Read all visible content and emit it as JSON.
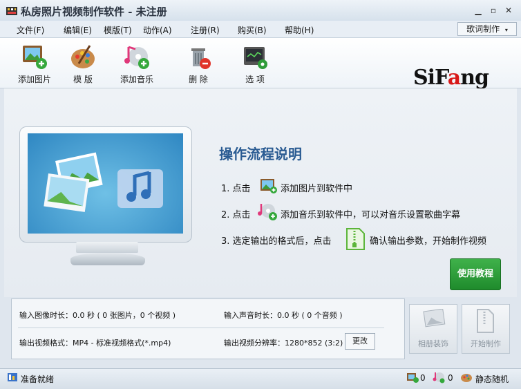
{
  "window": {
    "title": "私房照片视频制作软件 - 未注册"
  },
  "menu": [
    "文件(F)",
    "编辑(E)",
    "模版(T)",
    "动作(A)",
    "注册(R)",
    "购买(B)",
    "帮助(H)"
  ],
  "lyrics_button": "歌词制作",
  "toolbar": [
    {
      "label": "添加图片"
    },
    {
      "label": "模 版"
    },
    {
      "label": "添加音乐"
    },
    {
      "label": "删 除"
    },
    {
      "label": "选 项"
    }
  ],
  "logo": {
    "main": "SiF",
    "accent": "a",
    "rest": "ng"
  },
  "guide": {
    "title": "操作流程说明",
    "step1_prefix": "1. 点击",
    "step1_suffix": "添加图片到软件中",
    "step2_prefix": "2. 点击",
    "step2_suffix": "添加音乐到软件中，可以对音乐设置歌曲字幕",
    "step3_prefix": "3. 选定输出的格式后，点击",
    "step3_suffix": "确认输出参数，开始制作视频"
  },
  "tutorial_button": "使用教程",
  "info": {
    "image_duration": "输入图像时长：0.0 秒 ( 0 张图片，0 个视频 )",
    "audio_duration": "输入声音时长：0.0 秒 ( 0 个音频 )",
    "output_format": "输出视频格式：MP4 - 标准视频格式(*.mp4)",
    "output_resolution": "输出视频分辨率：1280*852 (3:2)",
    "change_button": "更改"
  },
  "actions": {
    "album": "相册装饰",
    "start": "开始制作"
  },
  "status": {
    "text": "准备就绪",
    "image_count": "0",
    "music_count": "0",
    "mode": "静态随机"
  },
  "colors": {
    "accent_green": "#2a9a36",
    "guide_blue": "#2a5b92",
    "logo_red": "#d81818"
  }
}
